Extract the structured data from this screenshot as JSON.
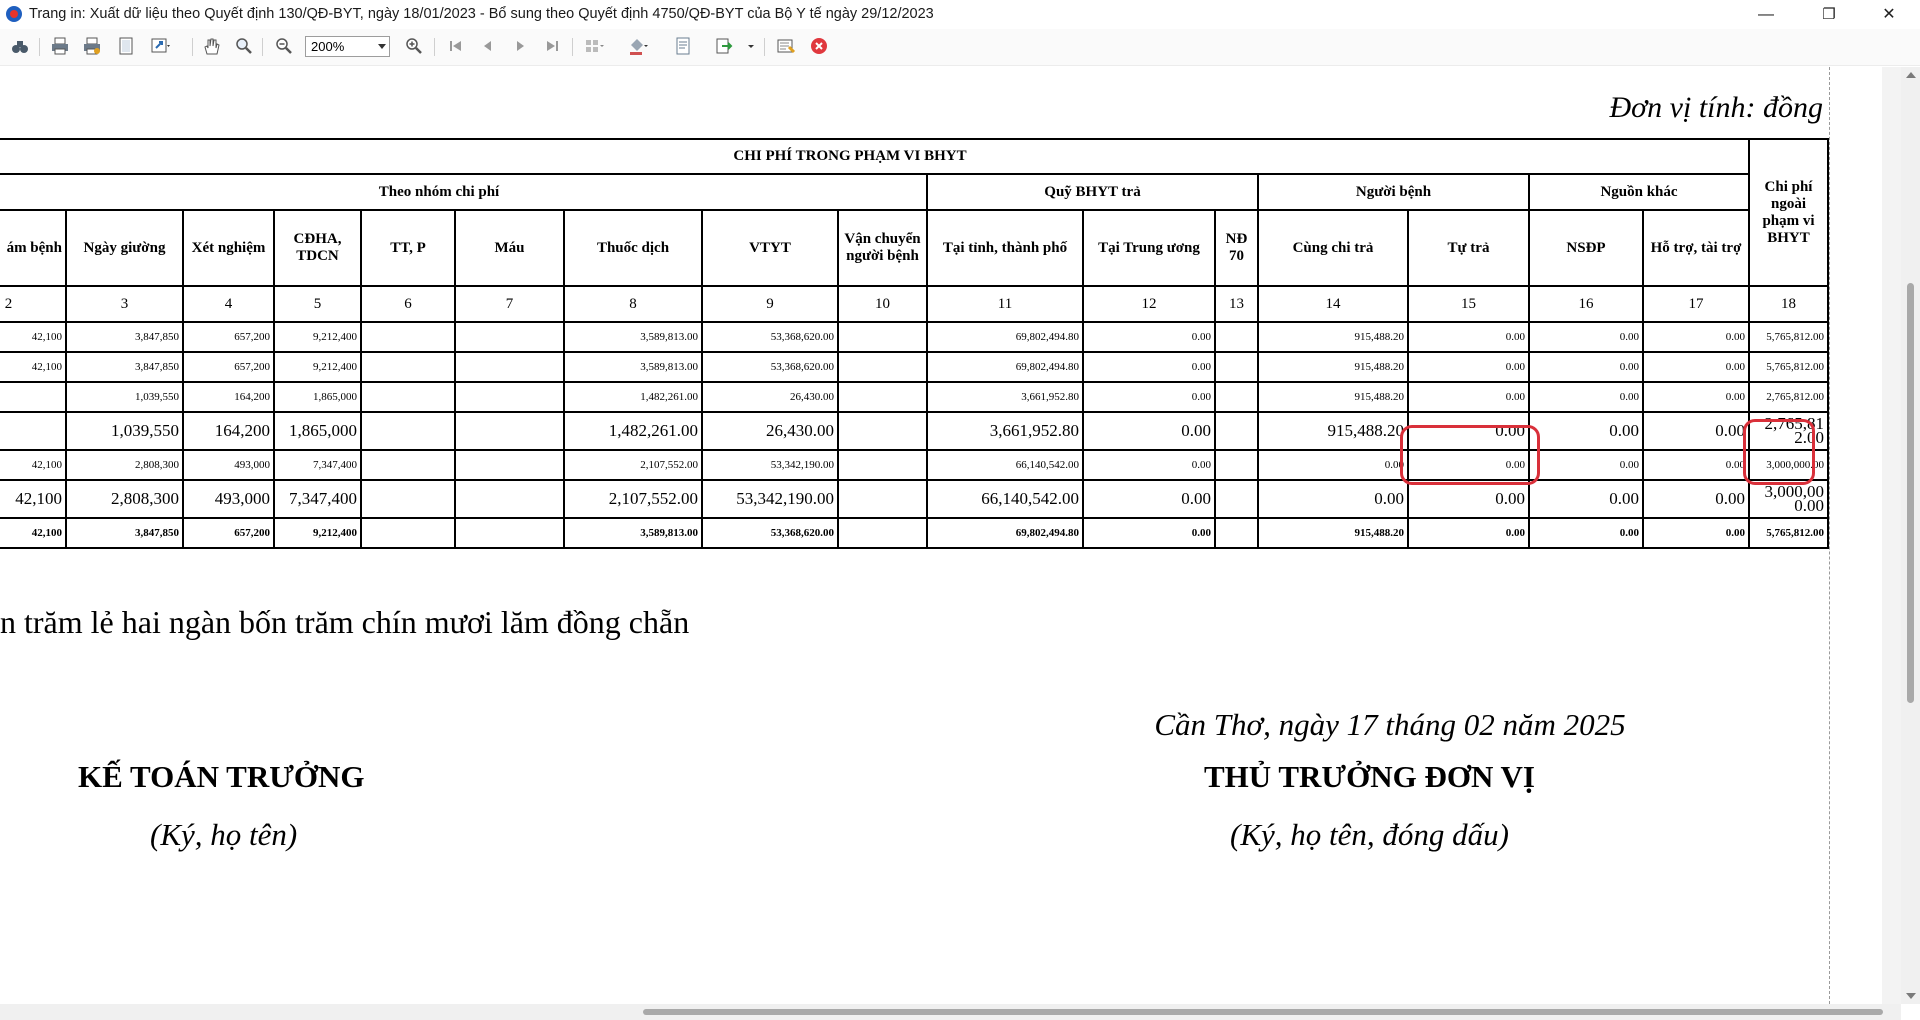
{
  "window": {
    "title": "Trang in: Xuất dữ liệu theo Quyết định 130/QĐ-BYT, ngày 18/01/2023 - Bổ sung theo Quyết định 4750/QĐ-BYT của Bộ Y tế ngày 29/12/2023",
    "minimize": "—",
    "restore": "❐",
    "close": "✕"
  },
  "toolbar": {
    "zoom": "200%",
    "icons": [
      "binoculars-icon",
      "print-icon",
      "quick-print-icon",
      "page-setup-icon",
      "scale-icon",
      "hand-tool-icon",
      "magnifier-icon",
      "zoom-out-icon",
      "zoom-in-icon",
      "first-page-icon",
      "previous-page-icon",
      "next-page-icon",
      "last-page-icon",
      "multiple-pages-icon",
      "fill-color-icon",
      "watermark-icon",
      "export-icon",
      "send-email-icon",
      "exit-icon"
    ]
  },
  "report": {
    "unit_line": "Đơn vị tính: đồng",
    "header": {
      "in_scope": "CHI PHÍ TRONG PHẠM VI BHYT",
      "by_group": "Theo nhóm chi phí",
      "fund_pays": "Quỹ BHYT trả",
      "patient": "Người bệnh",
      "other_sources": "Nguồn khác",
      "out_of_scope": "Chi phí ngoài phạm vi BHYT",
      "columns": [
        "ám bệnh",
        "Ngày giường",
        "Xét nghiệm",
        "CĐHA, TDCN",
        "TT, P",
        "Máu",
        "Thuốc dịch",
        "VTYT",
        "Vận chuyển người bệnh",
        "Tại tỉnh, thành phố",
        "Tại Trung ương",
        "NĐ 70",
        "Cùng chi trả",
        "Tự trả",
        "NSĐP",
        "Hỗ trợ, tài trợ"
      ],
      "numbers": [
        "2",
        "3",
        "4",
        "5",
        "6",
        "7",
        "8",
        "9",
        "10",
        "11",
        "12",
        "13",
        "14",
        "15",
        "16",
        "17",
        "18"
      ]
    },
    "rows": [
      [
        "42,100",
        "3,847,850",
        "657,200",
        "9,212,400",
        "",
        "",
        "3,589,813.00",
        "53,368,620.00",
        "",
        "69,802,494.80",
        "0.00",
        "",
        "915,488.20",
        "0.00",
        "0.00",
        "0.00",
        "5,765,812.00"
      ],
      [
        "42,100",
        "3,847,850",
        "657,200",
        "9,212,400",
        "",
        "",
        "3,589,813.00",
        "53,368,620.00",
        "",
        "69,802,494.80",
        "0.00",
        "",
        "915,488.20",
        "0.00",
        "0.00",
        "0.00",
        "5,765,812.00"
      ],
      [
        "",
        "1,039,550",
        "164,200",
        "1,865,000",
        "",
        "",
        "1,482,261.00",
        "26,430.00",
        "",
        "3,661,952.80",
        "0.00",
        "",
        "915,488.20",
        "0.00",
        "0.00",
        "0.00",
        "2,765,812.00"
      ],
      [
        "",
        "1,039,550",
        "164,200",
        "1,865,000",
        "",
        "",
        "1,482,261.00",
        "26,430.00",
        "",
        "3,661,952.80",
        "0.00",
        "",
        "915,488.20",
        "0.00",
        "0.00",
        "0.00",
        "2,765,812.00"
      ],
      [
        "42,100",
        "2,808,300",
        "493,000",
        "7,347,400",
        "",
        "",
        "2,107,552.00",
        "53,342,190.00",
        "",
        "66,140,542.00",
        "0.00",
        "",
        "0.00",
        "0.00",
        "0.00",
        "0.00",
        "3,000,000.00"
      ],
      [
        "42,100",
        "2,808,300",
        "493,000",
        "7,347,400",
        "",
        "",
        "2,107,552.00",
        "53,342,190.00",
        "",
        "66,140,542.00",
        "0.00",
        "",
        "0.00",
        "0.00",
        "0.00",
        "0.00",
        "3,000,000.00"
      ],
      [
        "42,100",
        "3,847,850",
        "657,200",
        "9,212,400",
        "",
        "",
        "3,589,813.00",
        "53,368,620.00",
        "",
        "69,802,494.80",
        "0.00",
        "",
        "915,488.20",
        "0.00",
        "0.00",
        "0.00",
        "5,765,812.00"
      ]
    ],
    "amount_in_words": "n trăm lẻ hai ngàn bốn trăm chín mươi lăm đồng chẵn",
    "place_date": "Cần Thơ, ngày 17 tháng 02 năm 2025",
    "signatures": {
      "left_title": "KẾ TOÁN TRƯỞNG",
      "left_note": "(Ký, họ tên)",
      "right_title": "THỦ TRƯỞNG ĐƠN VỊ",
      "right_note": "(Ký, họ tên, đóng dấu)"
    }
  },
  "colors": {
    "highlight": "#d9303a",
    "grid": "#000000"
  }
}
